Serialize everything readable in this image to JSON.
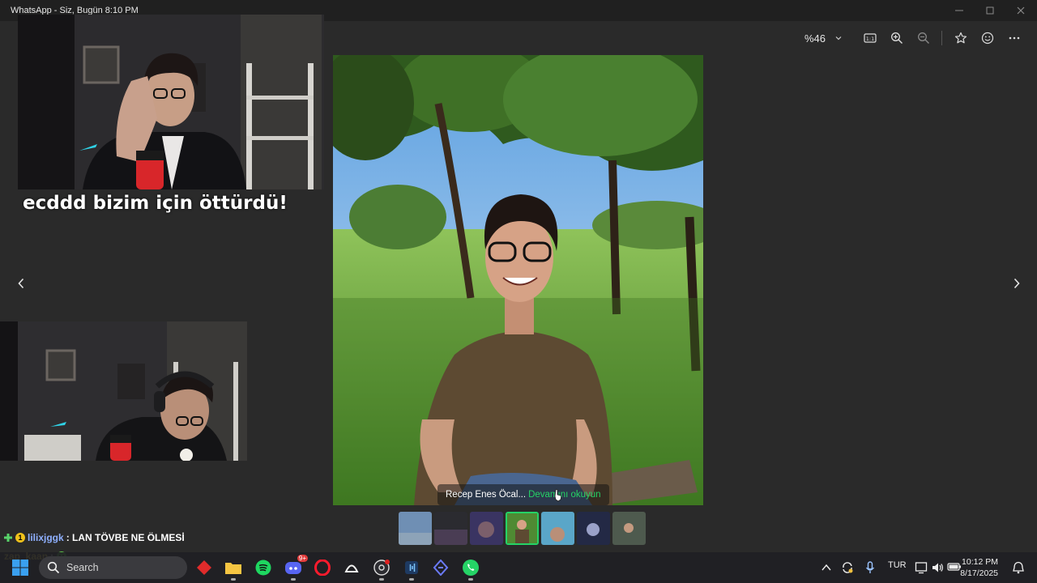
{
  "window": {
    "title": "WhatsApp - Siz, Bugün 8:10 PM"
  },
  "viewer": {
    "zoom_label": "%46",
    "overlay_text": "ecddd bizim için öttürdü!",
    "caption_author": "Recep Enes Öcal...",
    "caption_more": "Devamını okuyun",
    "thumbnail_count": 7,
    "active_thumbnail": 4
  },
  "chat": {
    "line1_badge": "1",
    "line1_user": "lilixjggk",
    "line1_text": ": LAN TÖVBE NE ÖLMESİ",
    "line2_user": "zap_kaan",
    "line2_sep": ":"
  },
  "taskbar": {
    "search_label": "Search",
    "lang": "TUR",
    "time": "10:12 PM",
    "date": "8/17/2025",
    "discord_badge": "9+"
  },
  "colors": {
    "accent": "#25d366",
    "titlebar": "#202020",
    "background": "#2a2a2a"
  }
}
